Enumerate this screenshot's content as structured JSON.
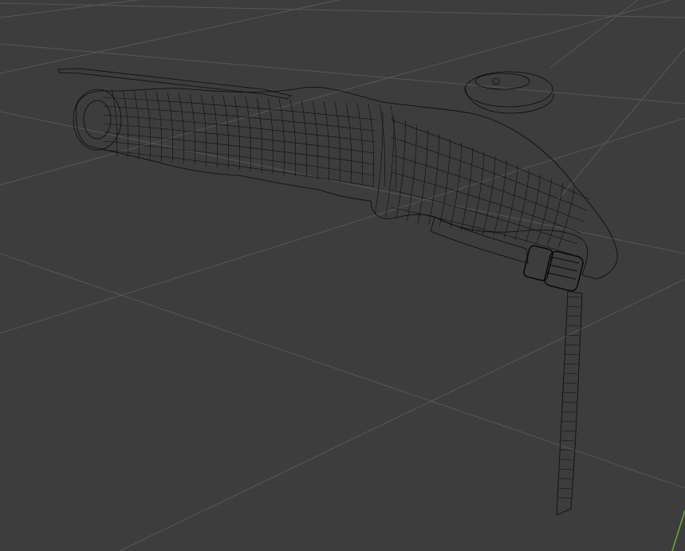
{
  "viewport": {
    "mode": "wireframe",
    "background_color": "#3d3d3d",
    "grid_line_color": "#575757",
    "wire_color": "#0b0b0b",
    "y_axis_color": "#6fa83a"
  },
  "icons": {
    "buckle": "buckle-icon"
  }
}
